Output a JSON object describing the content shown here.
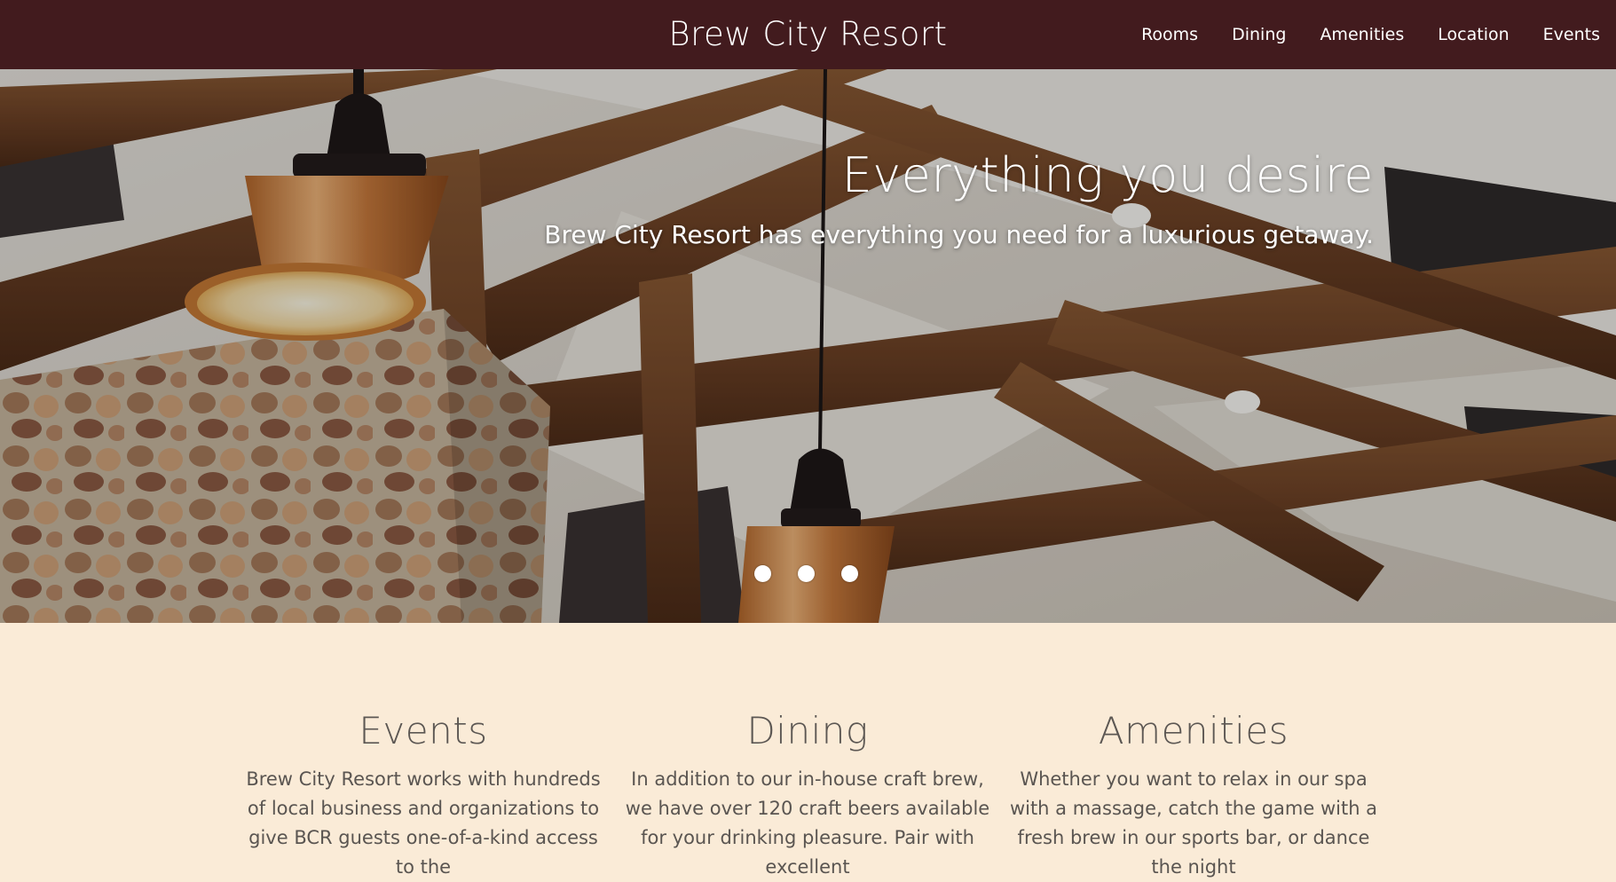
{
  "navbar": {
    "brand": "Brew City Resort",
    "links": [
      "Rooms",
      "Dining",
      "Amenities",
      "Location",
      "Events"
    ]
  },
  "hero": {
    "title": "Everything you desire",
    "subtitle": "Brew City Resort has everything you need for a luxurious getaway.",
    "carousel_slides": 3
  },
  "features": [
    {
      "heading": "Events",
      "text": "Brew City Resort works with hundreds of local business and organizations to give BCR guests one-of-a-kind access to the"
    },
    {
      "heading": "Dining",
      "text": "In addition to our in-house craft brew, we have over 120 craft beers available for your drinking pleasure. Pair with excellent"
    },
    {
      "heading": "Amenities",
      "text": "Whether you want to relax in our spa with a massage, catch the game with a fresh brew in our sports bar, or dance the night"
    }
  ],
  "colors": {
    "navbar_bg": "#421b1e",
    "page_bg": "#faebd7",
    "text": "#5a5551"
  }
}
